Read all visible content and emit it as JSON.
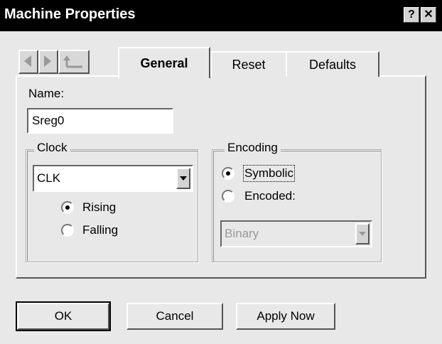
{
  "window": {
    "title": "Machine Properties",
    "help_label": "?",
    "close_label": "✕"
  },
  "nav": {
    "back_icon": "arrow-left-icon",
    "forward_icon": "arrow-right-icon",
    "up_icon": "up-level-icon"
  },
  "tabs": [
    {
      "label": "General",
      "active": true
    },
    {
      "label": "Reset",
      "active": false
    },
    {
      "label": "Defaults",
      "active": false
    }
  ],
  "general": {
    "name_label": "Name:",
    "name_value": "Sreg0",
    "clock": {
      "legend": "Clock",
      "selected": "CLK",
      "edges": [
        {
          "label": "Rising",
          "checked": true
        },
        {
          "label": "Falling",
          "checked": false
        }
      ]
    },
    "encoding": {
      "legend": "Encoding",
      "options": [
        {
          "label": "Symbolic",
          "checked": true
        },
        {
          "label": "Encoded:",
          "checked": false
        }
      ],
      "encoded_type": "Binary",
      "encoded_enabled": false
    }
  },
  "buttons": {
    "ok": "OK",
    "cancel": "Cancel",
    "apply": "Apply Now"
  }
}
